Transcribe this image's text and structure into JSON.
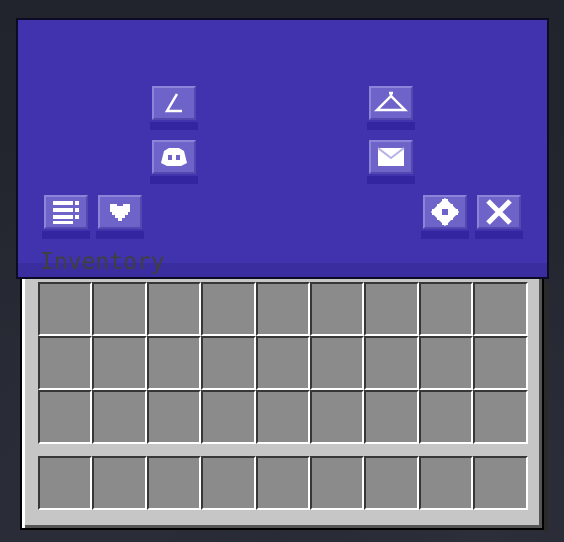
{
  "inventory": {
    "title": "Inventory",
    "main_rows": 3,
    "columns": 9,
    "hotbar_slots": 9
  },
  "overlay": {
    "color": "#4133ad",
    "buttons": [
      {
        "id": "angle",
        "icon": "angle-icon"
      },
      {
        "id": "hanger",
        "icon": "hanger-icon"
      },
      {
        "id": "discord",
        "icon": "discord-icon"
      },
      {
        "id": "mail",
        "icon": "mail-icon"
      },
      {
        "id": "list",
        "icon": "list-icon"
      },
      {
        "id": "heart",
        "icon": "heart-icon"
      },
      {
        "id": "settings",
        "icon": "gear-icon"
      },
      {
        "id": "close",
        "icon": "close-icon"
      }
    ]
  },
  "colors": {
    "slot": "#8b8b8b",
    "panel": "#c6c6c6",
    "button": "#6d63c9"
  }
}
